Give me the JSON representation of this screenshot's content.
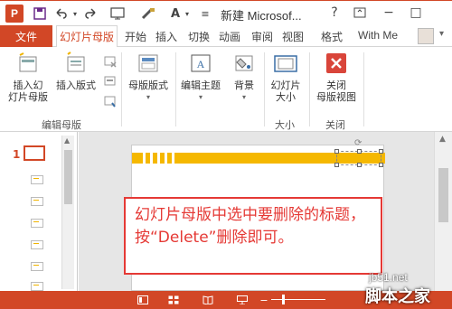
{
  "app": {
    "title": "新建 Microsof...",
    "logo_letter": "P",
    "accent": "#d24726"
  },
  "quick_access": {
    "icons": [
      "save-icon",
      "undo-icon",
      "redo-icon",
      "from-beginning-icon",
      "format-painter-icon",
      "font-size-icon"
    ],
    "font_label": "A"
  },
  "window_controls": {
    "help": "?",
    "ribbon_display": "▭",
    "minimize": "−",
    "maximize": "□"
  },
  "tabs": {
    "file": "文件",
    "items": [
      "幻灯片母版",
      "开始",
      "插入",
      "切换",
      "动画",
      "审阅",
      "视图",
      "格式"
    ],
    "active": "幻灯片母版",
    "user": "With Me"
  },
  "ribbon": {
    "groups": {
      "edit_master": {
        "label": "编辑母版",
        "insert_master": "插入幻\n灯片母版",
        "insert_layout": "插入版式"
      },
      "master_layout": {
        "label": "母版版式"
      },
      "edit_theme": {
        "label": "编辑主题"
      },
      "background": {
        "label": "背景"
      },
      "size": {
        "label": "大小",
        "slide_size": "幻灯片\n大小"
      },
      "close": {
        "label": "关闭",
        "close_master": "关闭\n母版视图"
      }
    }
  },
  "slides_panel": {
    "master_number": "1",
    "layout_count": 6
  },
  "callout": {
    "text": "幻灯片母版中选中要删除的标题，按“Delete”删除即可。",
    "color": "#e53935"
  },
  "slide": {
    "bar_color": "#f5b800"
  },
  "watermark": {
    "url": "jb51.net",
    "name": "脚本之家"
  }
}
